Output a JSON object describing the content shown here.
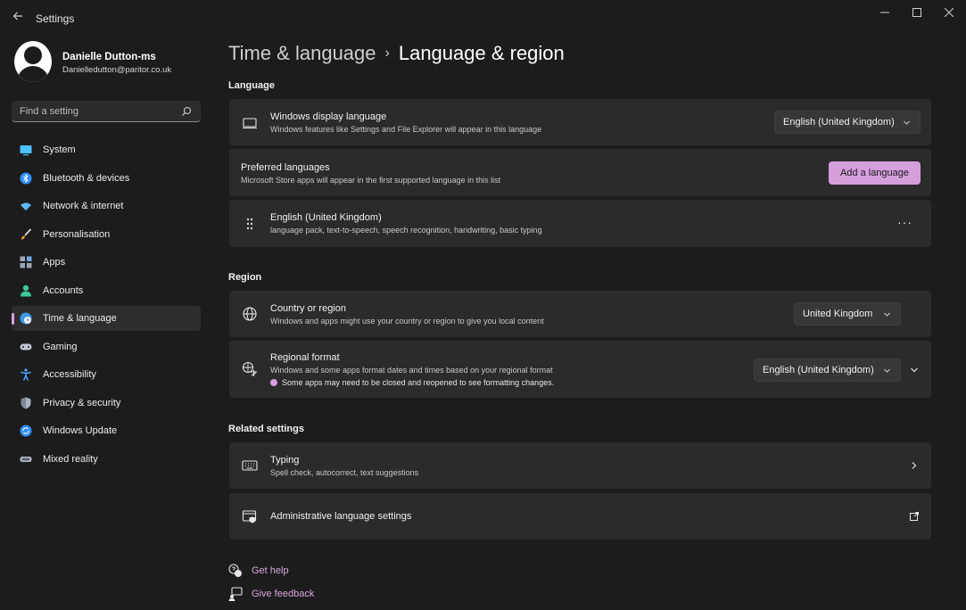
{
  "window": {
    "title": "Settings",
    "back_icon": "back-arrow-icon",
    "controls": [
      "minimize-icon",
      "maximize-icon",
      "close-icon"
    ]
  },
  "profile": {
    "name": "Danielle Dutton-ms",
    "email": "Danielledutton@paritor.co.uk"
  },
  "search": {
    "placeholder": "Find a setting",
    "icon": "search-icon"
  },
  "sidebar": {
    "items": [
      {
        "label": "System",
        "icon": "system-icon",
        "active": false
      },
      {
        "label": "Bluetooth & devices",
        "icon": "bluetooth-icon",
        "active": false
      },
      {
        "label": "Network & internet",
        "icon": "network-icon",
        "active": false
      },
      {
        "label": "Personalisation",
        "icon": "brush-icon",
        "active": false
      },
      {
        "label": "Apps",
        "icon": "apps-icon",
        "active": false
      },
      {
        "label": "Accounts",
        "icon": "accounts-icon",
        "active": false
      },
      {
        "label": "Time & language",
        "icon": "globe-clock-icon",
        "active": true
      },
      {
        "label": "Gaming",
        "icon": "gamepad-icon",
        "active": false
      },
      {
        "label": "Accessibility",
        "icon": "accessibility-icon",
        "active": false
      },
      {
        "label": "Privacy & security",
        "icon": "shield-icon",
        "active": false
      },
      {
        "label": "Windows Update",
        "icon": "update-icon",
        "active": false
      },
      {
        "label": "Mixed reality",
        "icon": "headset-icon",
        "active": false
      }
    ]
  },
  "breadcrumb": {
    "parent": "Time & language",
    "separator": "›",
    "current": "Language & region"
  },
  "language": {
    "section_title": "Language",
    "display_language": {
      "title": "Windows display language",
      "subtitle": "Windows features like Settings and File Explorer will appear in this language",
      "value": "English (United Kingdom)"
    },
    "preferred": {
      "title": "Preferred languages",
      "subtitle": "Microsoft Store apps will appear in the first supported language in this list",
      "button": "Add a language"
    },
    "installed": {
      "title": "English (United Kingdom)",
      "subtitle": "language pack, text-to-speech, speech recognition, handwriting, basic typing",
      "more": "···"
    }
  },
  "region": {
    "section_title": "Region",
    "country": {
      "title": "Country or region",
      "subtitle": "Windows and apps might use your country or region to give you local content",
      "value": "United Kingdom"
    },
    "format": {
      "title": "Regional format",
      "subtitle": "Windows and some apps format dates and times based on your regional format",
      "notice": "Some apps may need to be closed and reopened to see formatting changes.",
      "value": "English (United Kingdom)"
    }
  },
  "related": {
    "section_title": "Related settings",
    "typing": {
      "title": "Typing",
      "subtitle": "Spell check, autocorrect, text suggestions"
    },
    "admin": {
      "title": "Administrative language settings"
    }
  },
  "footer": {
    "help": "Get help",
    "feedback": "Give feedback"
  },
  "colors": {
    "accent": "#d59fdc",
    "background": "#1c1c1c",
    "card": "#2b2b2b"
  }
}
